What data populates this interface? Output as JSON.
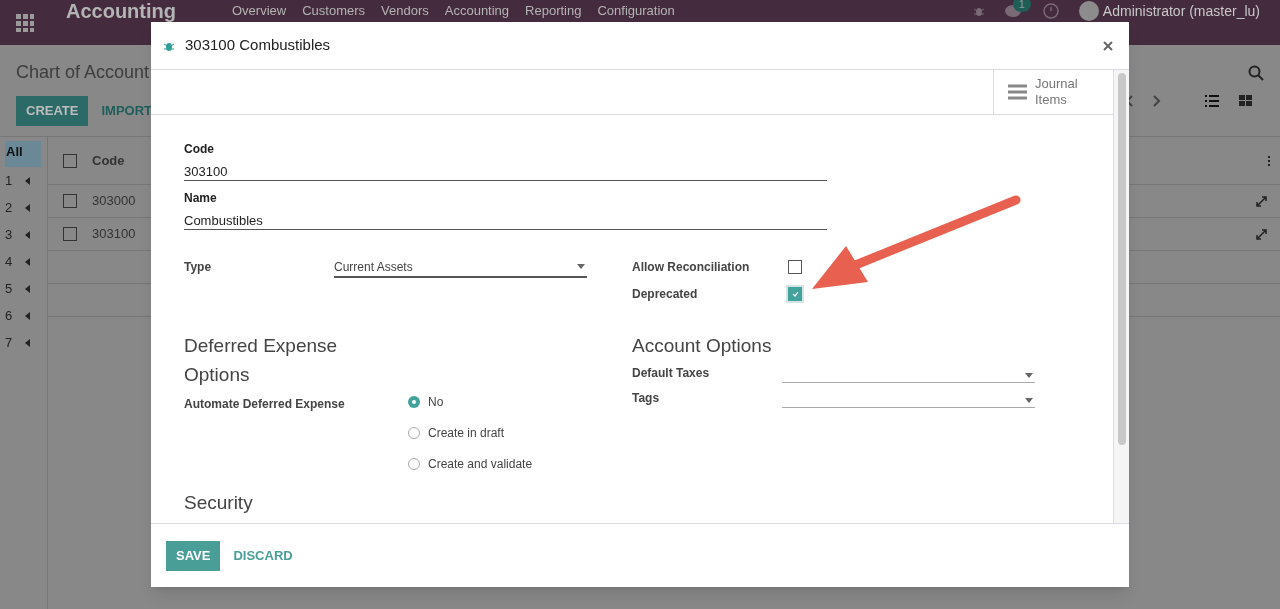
{
  "top_bar": {
    "app_title": "Accounting",
    "menu": [
      "Overview",
      "Customers",
      "Vendors",
      "Accounting",
      "Reporting",
      "Configuration"
    ],
    "chat_badge": "1",
    "user": "Administrator (master_lu)"
  },
  "control_panel": {
    "breadcrumb": "Chart of Account",
    "create": "CREATE",
    "import": "IMPORT"
  },
  "group_sidebar": {
    "all": {
      "label": "All",
      "selected": true
    },
    "groups": [
      "1",
      "2",
      "3",
      "4",
      "5",
      "6",
      "7"
    ]
  },
  "list": {
    "column": "Code",
    "header_checked": false,
    "rows": [
      {
        "code": "303000",
        "checked": false
      },
      {
        "code": "303100",
        "checked": false
      }
    ]
  },
  "dialog": {
    "title": "303100 Combustibles",
    "smart_button": "Journal Items",
    "code": {
      "label": "Code",
      "value": "303100"
    },
    "name": {
      "label": "Name",
      "value": "Combustibles"
    },
    "type": {
      "label": "Type",
      "value": "Current Assets"
    },
    "checkboxes": [
      {
        "label": "Allow Reconciliation",
        "checked": false
      },
      {
        "label": "Deprecated",
        "checked": true
      }
    ],
    "deferred": {
      "title": "Deferred Expense Options",
      "label": "Automate Deferred Expense",
      "options": [
        {
          "label": "No",
          "selected": true
        },
        {
          "label": "Create in draft",
          "selected": false
        },
        {
          "label": "Create and validate",
          "selected": false
        }
      ]
    },
    "account_options": {
      "title": "Account Options",
      "fields": [
        "Default Taxes",
        "Tags"
      ]
    },
    "next_section": "Security",
    "save": "SAVE",
    "discard": "DISCARD"
  }
}
